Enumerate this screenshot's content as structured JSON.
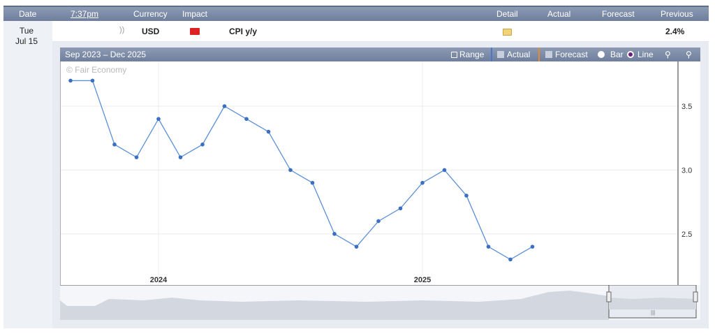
{
  "header": {
    "date": "Date",
    "time": "7:37pm",
    "currency": "Currency",
    "impact": "Impact",
    "detail": "Detail",
    "actual": "Actual",
    "forecast": "Forecast",
    "previous": "Previous"
  },
  "event": {
    "day": "Tue",
    "date": "Jul 15",
    "currency": "USD",
    "name": "CPI y/y",
    "previous": "2.4%"
  },
  "chart_toolbar": {
    "range_label": "Sep 2023 – Dec 2025",
    "range_button": "Range",
    "actual_label": "Actual",
    "forecast_label": "Forecast",
    "bar_label": "Bar",
    "line_label": "Line"
  },
  "watermark": "© Fair Economy",
  "colors": {
    "line": "#5b8fd6",
    "point": "#3a6fc4",
    "impact": "#d22222"
  },
  "chart_data": {
    "type": "line",
    "x": [
      "2023-09",
      "2023-10",
      "2023-11",
      "2023-12",
      "2024-01",
      "2024-02",
      "2024-03",
      "2024-04",
      "2024-05",
      "2024-06",
      "2024-07",
      "2024-08",
      "2024-09",
      "2024-10",
      "2024-11",
      "2024-12",
      "2025-01",
      "2025-02",
      "2025-03",
      "2025-04",
      "2025-05",
      "2025-06"
    ],
    "series": [
      {
        "values": [
          3.7,
          3.7,
          3.2,
          3.1,
          3.4,
          3.1,
          3.2,
          3.5,
          3.4,
          3.3,
          3.0,
          2.9,
          2.5,
          2.4,
          2.6,
          2.7,
          2.9,
          3.0,
          2.8,
          2.4,
          2.3,
          2.4
        ]
      }
    ],
    "y_ticks": [
      "3.5",
      "3.0",
      "2.5"
    ],
    "x_tick_labels": [
      "2024",
      "2025"
    ],
    "ylim": [
      2.1,
      3.85
    ],
    "grid": true
  }
}
